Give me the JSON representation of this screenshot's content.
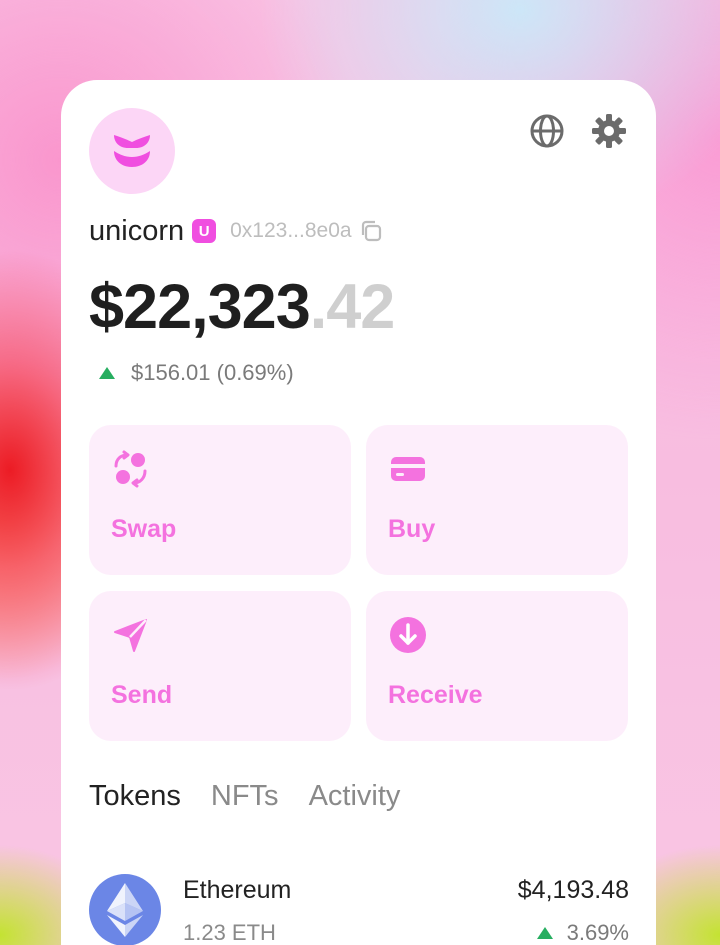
{
  "colors": {
    "accent": "#f472df",
    "accent_bg": "#fdeefb",
    "positive": "#27ae60",
    "avatar_bg": "#fcd6f6",
    "eth_blue": "#6b86e6"
  },
  "header": {
    "icons": [
      "globe-icon",
      "gear-icon"
    ]
  },
  "account": {
    "username": "unicorn",
    "unitag_letter": "U",
    "address": "0x123...8e0a"
  },
  "balance": {
    "whole": "$22,323",
    "cents": ".42",
    "change": "$156.01 (0.69%)"
  },
  "actions": [
    {
      "label": "Swap",
      "icon": "swap-icon"
    },
    {
      "label": "Buy",
      "icon": "card-icon"
    },
    {
      "label": "Send",
      "icon": "send-icon"
    },
    {
      "label": "Receive",
      "icon": "receive-icon"
    }
  ],
  "tabs": [
    {
      "label": "Tokens",
      "active": true
    },
    {
      "label": "NFTs",
      "active": false
    },
    {
      "label": "Activity",
      "active": false
    }
  ],
  "tokens": [
    {
      "name": "Ethereum",
      "amount": "1.23 ETH",
      "value": "$4,193.48",
      "change": "3.69%",
      "icon": "ethereum-icon"
    }
  ]
}
